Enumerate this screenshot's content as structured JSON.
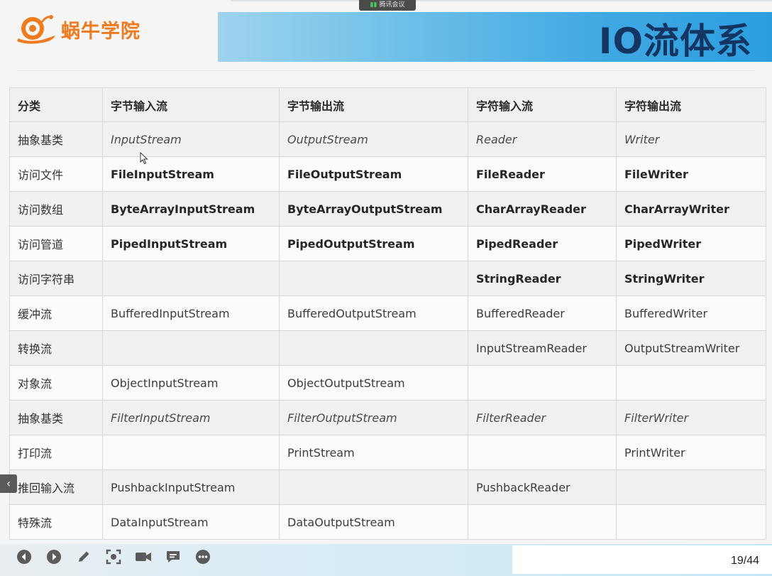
{
  "header": {
    "logo_text": "蜗牛学院",
    "title": "IO流体系",
    "meeting_label": "腾讯会议",
    "brand_orange": "#f07b1f",
    "title_color": "#14355f"
  },
  "table": {
    "headers": [
      "分类",
      "字节输入流",
      "字节输出流",
      "字符输入流",
      "字符输出流"
    ],
    "rows": [
      {
        "category": "抽象基类",
        "byte_in": "InputStream",
        "byte_out": "OutputStream",
        "char_in": "Reader",
        "char_out": "Writer",
        "style": "italic"
      },
      {
        "category": "访问文件",
        "byte_in": "FileInputStream",
        "byte_out": "FileOutputStream",
        "char_in": "FileReader",
        "char_out": "FileWriter",
        "style": "bold"
      },
      {
        "category": "访问数组",
        "byte_in": "ByteArrayInputStream",
        "byte_out": "ByteArrayOutputStream",
        "char_in": "CharArrayReader",
        "char_out": "CharArrayWriter",
        "style": "bold"
      },
      {
        "category": "访问管道",
        "byte_in": "PipedInputStream",
        "byte_out": "PipedOutputStream",
        "char_in": "PipedReader",
        "char_out": "PipedWriter",
        "style": "bold"
      },
      {
        "category": "访问字符串",
        "byte_in": "",
        "byte_out": "",
        "char_in": "StringReader",
        "char_out": "StringWriter",
        "style": "bold"
      },
      {
        "category": "缓冲流",
        "byte_in": "BufferedInputStream",
        "byte_out": "BufferedOutputStream",
        "char_in": "BufferedReader",
        "char_out": "BufferedWriter",
        "style": "normal"
      },
      {
        "category": "转换流",
        "byte_in": "",
        "byte_out": "",
        "char_in": "InputStreamReader",
        "char_out": "OutputStreamWriter",
        "style": "normal"
      },
      {
        "category": "对象流",
        "byte_in": "ObjectInputStream",
        "byte_out": "ObjectOutputStream",
        "char_in": "",
        "char_out": "",
        "style": "normal"
      },
      {
        "category": "抽象基类",
        "byte_in": "FilterInputStream",
        "byte_out": "FilterOutputStream",
        "char_in": "FilterReader",
        "char_out": "FilterWriter",
        "style": "italic"
      },
      {
        "category": "打印流",
        "byte_in": "",
        "byte_out": "PrintStream",
        "char_in": "",
        "char_out": "PrintWriter",
        "style": "normal"
      },
      {
        "category": "推回输入流",
        "byte_in": "PushbackInputStream",
        "byte_out": "",
        "char_in": "PushbackReader",
        "char_out": "",
        "style": "normal"
      },
      {
        "category": "特殊流",
        "byte_in": "DataInputStream",
        "byte_out": "DataOutputStream",
        "char_in": "",
        "char_out": "",
        "style": "normal"
      }
    ]
  },
  "toolbar": {
    "icons": [
      "prev-icon",
      "next-icon",
      "pen-icon",
      "screenshot-icon",
      "camera-icon",
      "comment-icon",
      "more-icon"
    ],
    "page_indicator": "19/44"
  },
  "side": {
    "collapse_glyph": "‹"
  }
}
